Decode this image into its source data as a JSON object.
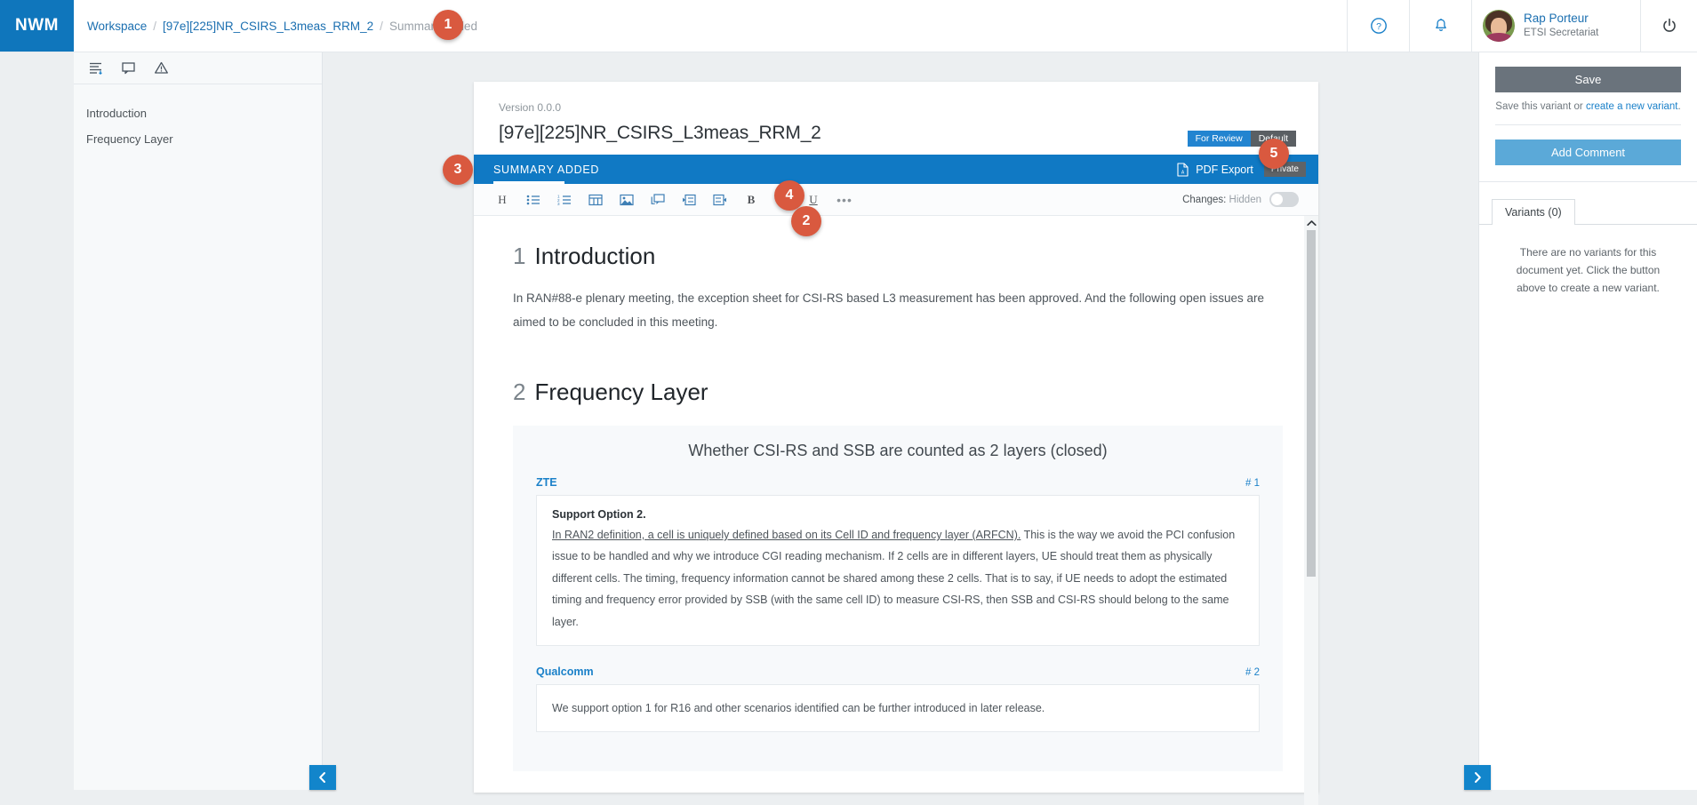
{
  "app": {
    "brand": "NWM"
  },
  "breadcrumb": {
    "workspace": "Workspace",
    "sep": "/",
    "document": "[97e][225]NR_CSIRS_L3meas_RRM_2",
    "current": "Summary added"
  },
  "user": {
    "name": "Rap Porteur",
    "role": "ETSI Secretariat"
  },
  "callouts": {
    "one": "1",
    "two": "2",
    "three": "3",
    "four": "4",
    "five": "5"
  },
  "left_panel": {
    "icons": [
      {
        "name": "outline-icon"
      },
      {
        "name": "comment-icon"
      },
      {
        "name": "warning-icon"
      }
    ],
    "items": [
      {
        "label": "Introduction"
      },
      {
        "label": "Frequency Layer"
      }
    ]
  },
  "document": {
    "version": "Version 0.0.0",
    "title": "[97e][225]NR_CSIRS_L3meas_RRM_2",
    "badges": {
      "review": "For Review",
      "default": "Default"
    },
    "summary_bar": {
      "label": "SUMMARY ADDED",
      "pdf_export": "PDF Export",
      "private": "Private"
    },
    "toolbar": {
      "heading": "H",
      "bold": "B",
      "italic": "I",
      "underline": "U",
      "more": "•••",
      "changes_label": "Changes:",
      "changes_value": "Hidden"
    },
    "sections": [
      {
        "number": "1",
        "heading": "Introduction",
        "paragraph": "In RAN#88-e plenary meeting, the exception sheet for CSI-RS based L3 measurement has been approved. And the following open issues are aimed to be concluded in this meeting."
      },
      {
        "number": "2",
        "heading": "Frequency Layer",
        "issue_title": "Whether CSI-RS and SSB are counted as 2 layers (closed)",
        "contributions": [
          {
            "company": "ZTE",
            "id": "# 1",
            "strong": "Support Option 2.",
            "underlined": "In RAN2 definition, a cell is uniquely defined based on its Cell ID and frequency layer (ARFCN).",
            "text": " This is the way we avoid the PCI confusion issue to be handled and why we introduce CGI reading mechanism. If 2 cells are in different layers, UE should treat them as physically different cells. The timing, frequency information cannot be shared among these 2 cells. That is to say, if UE needs to adopt the estimated timing and frequency error provided by SSB (with the same cell ID) to measure CSI-RS, then SSB and CSI-RS should belong to the same layer."
          },
          {
            "company": "Qualcomm",
            "id": "# 2",
            "strong": "",
            "underlined": "",
            "text": "We support option 1 for R16 and other scenarios identified can be further introduced in later release."
          }
        ]
      }
    ]
  },
  "right_panel": {
    "save_label": "Save",
    "save_hint_prefix": "Save this variant or ",
    "save_hint_link": "create a new variant",
    "save_hint_suffix": ".",
    "add_comment_label": "Add Comment",
    "tab_label": "Variants (0)",
    "empty_message": "There are no variants for this document yet. Click the button above to create a new variant."
  },
  "colors": {
    "brand_blue": "#0f76bc",
    "summary_blue": "#1079c4",
    "callout_orange": "#d9593f",
    "accent_link": "#1b81c9"
  }
}
